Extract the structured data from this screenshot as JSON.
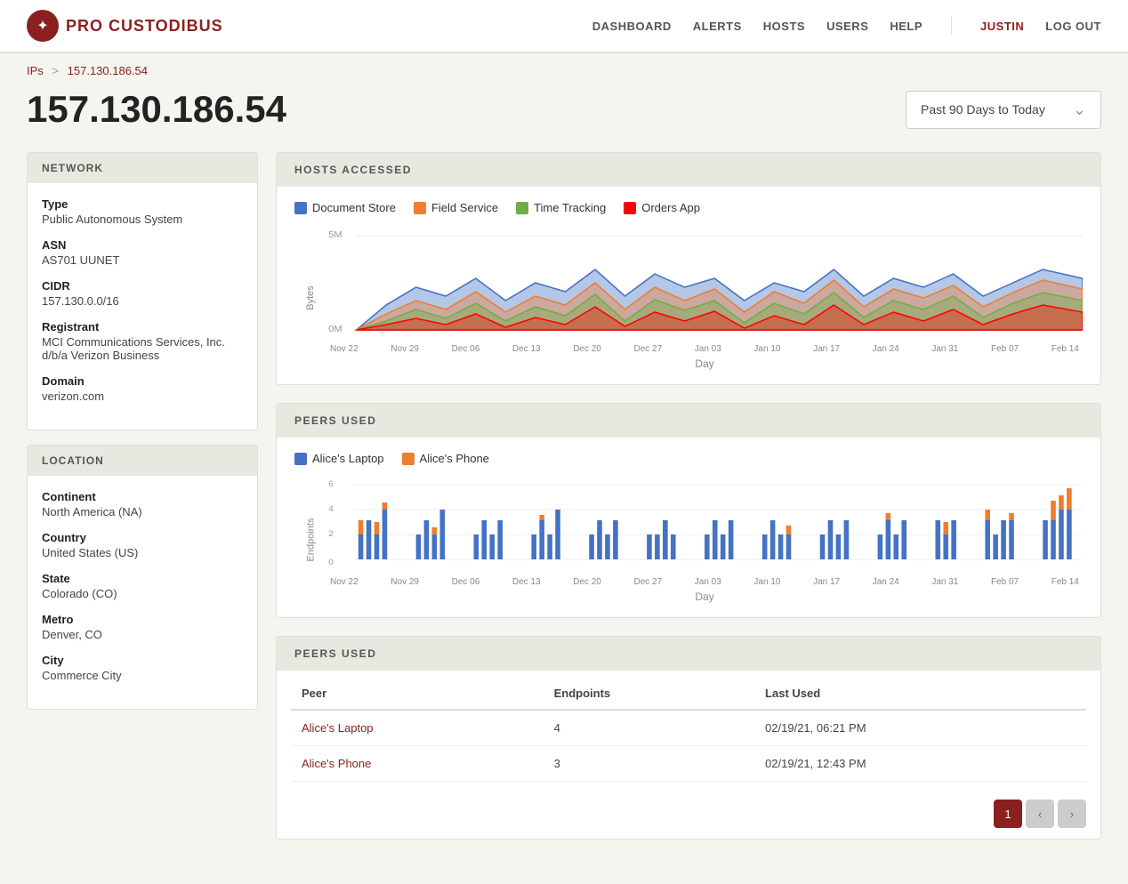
{
  "header": {
    "logo_text": "PRO CUSTODIBUS",
    "nav_items": [
      {
        "label": "DASHBOARD",
        "href": "#"
      },
      {
        "label": "ALERTS",
        "href": "#"
      },
      {
        "label": "HOSTS",
        "href": "#"
      },
      {
        "label": "USERS",
        "href": "#"
      },
      {
        "label": "HELP",
        "href": "#"
      }
    ],
    "user_name": "JUSTIN",
    "logout_label": "LOG OUT"
  },
  "breadcrumb": {
    "parent_label": "IPs",
    "separator": ">",
    "current_label": "157.130.186.54"
  },
  "page": {
    "title": "157.130.186.54",
    "date_filter": "Past 90 Days to Today"
  },
  "network_card": {
    "header": "NETWORK",
    "fields": [
      {
        "label": "Type",
        "value": "Public Autonomous System"
      },
      {
        "label": "ASN",
        "value": "AS701 UUNET"
      },
      {
        "label": "CIDR",
        "value": "157.130.0.0/16"
      },
      {
        "label": "Registrant",
        "value": "MCI Communications Services, Inc. d/b/a Verizon Business"
      },
      {
        "label": "Domain",
        "value": "verizon.com"
      }
    ]
  },
  "location_card": {
    "header": "LOCATION",
    "fields": [
      {
        "label": "Continent",
        "value": "North America (NA)"
      },
      {
        "label": "Country",
        "value": "United States (US)"
      },
      {
        "label": "State",
        "value": "Colorado (CO)"
      },
      {
        "label": "Metro",
        "value": "Denver, CO"
      },
      {
        "label": "City",
        "value": "Commerce City"
      }
    ]
  },
  "hosts_chart": {
    "header": "HOSTS ACCESSED",
    "legend": [
      {
        "label": "Document Store",
        "color": "#4472C4"
      },
      {
        "label": "Field Service",
        "color": "#ED7D31"
      },
      {
        "label": "Time Tracking",
        "color": "#70AD47"
      },
      {
        "label": "Orders App",
        "color": "#FF0000"
      }
    ],
    "y_label": "Bytes",
    "x_label": "Day",
    "y_ticks": [
      "5M",
      "0M"
    ],
    "x_ticks": [
      "Nov 22",
      "Nov 29",
      "Dec 06",
      "Dec 13",
      "Dec 20",
      "Dec 27",
      "Jan 03",
      "Jan 10",
      "Jan 17",
      "Jan 24",
      "Jan 31",
      "Feb 07",
      "Feb 14"
    ]
  },
  "peers_chart": {
    "header": "PEERS USED",
    "legend": [
      {
        "label": "Alice's Laptop",
        "color": "#4472C4"
      },
      {
        "label": "Alice's Phone",
        "color": "#ED7D31"
      }
    ],
    "y_label": "Endpoints",
    "x_label": "Day",
    "y_ticks": [
      "6",
      "4",
      "2",
      "0"
    ],
    "x_ticks": [
      "Nov 22",
      "Nov 29",
      "Dec 06",
      "Dec 13",
      "Dec 20",
      "Dec 27",
      "Jan 03",
      "Jan 10",
      "Jan 17",
      "Jan 24",
      "Jan 31",
      "Feb 07",
      "Feb 14"
    ]
  },
  "peers_table": {
    "header": "PEERS USED",
    "columns": [
      "Peer",
      "Endpoints",
      "Last Used"
    ],
    "rows": [
      {
        "peer": "Alice's Laptop",
        "peer_href": "#",
        "endpoints": "4",
        "last_used": "02/19/21, 06:21 PM"
      },
      {
        "peer": "Alice's Phone",
        "peer_href": "#",
        "endpoints": "3",
        "last_used": "02/19/21, 12:43 PM"
      }
    ],
    "pagination": {
      "current_page": "1",
      "prev_label": "‹",
      "next_label": "›"
    }
  }
}
